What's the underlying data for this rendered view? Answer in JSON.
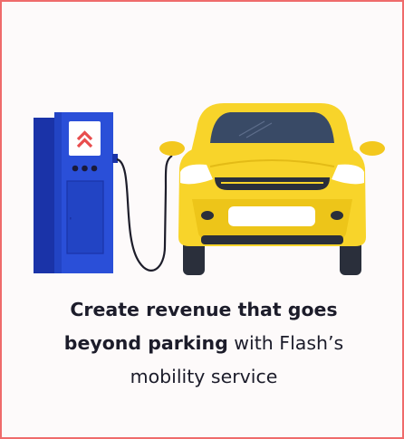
{
  "caption": {
    "bold_lead": "Create revenue that goes beyond parking",
    "rest": " with Flash’s mobility service"
  },
  "icons": {
    "charger": "ev-charging-station-icon",
    "car": "yellow-car-icon",
    "logo": "flash-chevron-logo-icon",
    "cable": "charging-cable-icon"
  },
  "colors": {
    "border": "#ef6b6b",
    "charger_blue": "#2a4fd8",
    "charger_dark": "#1a33a8",
    "car_yellow": "#f8d42a",
    "logo_red": "#e84d4d",
    "text": "#1c1c2a"
  }
}
